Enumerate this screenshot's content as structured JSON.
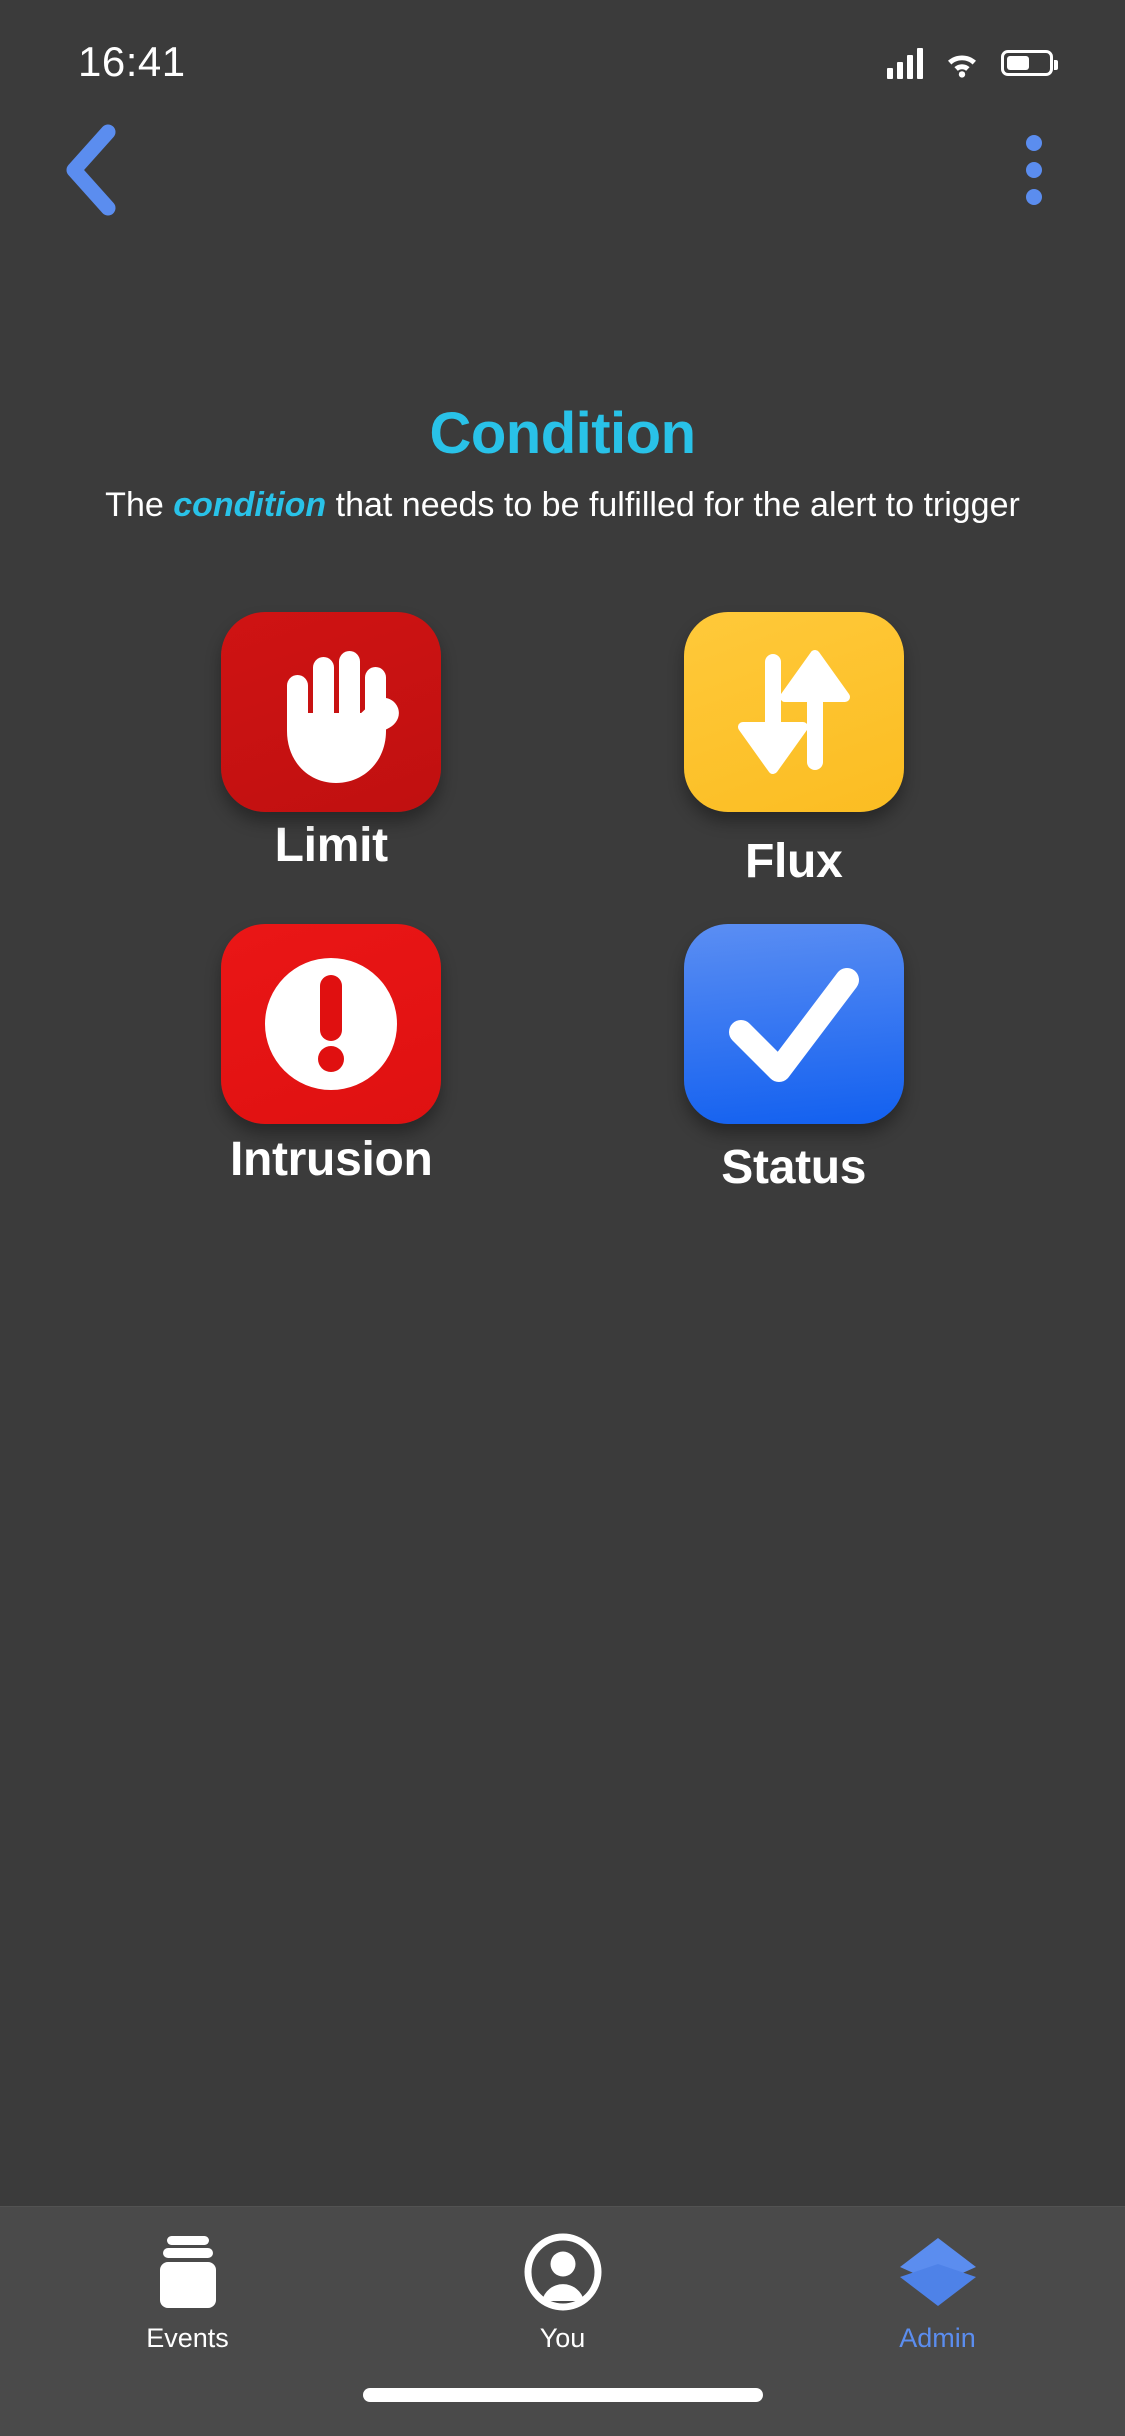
{
  "status_bar": {
    "time": "16:41",
    "signal_icon": "cellular-signal-icon",
    "wifi_icon": "wifi-icon",
    "battery_icon": "battery-icon"
  },
  "nav": {
    "back_icon": "chevron-left-icon",
    "menu_icon": "overflow-menu-icon"
  },
  "header": {
    "title": "Condition",
    "subtitle_prefix": "The ",
    "subtitle_highlight": "condition",
    "subtitle_suffix": " that needs to be fulfilled for the alert to trigger"
  },
  "colors": {
    "accent_cyan": "#29c2e8",
    "accent_blue": "#5b8def",
    "page_bg": "#3b3b3b",
    "tabbar_bg": "#4a4a4a",
    "limit_red": "#c81313",
    "flux_amber": "#fbbd22",
    "intrusion_red": "#e51616",
    "status_blue": "#1260f0"
  },
  "options": [
    {
      "id": "limit",
      "label": "Limit",
      "icon": "hand-stop-icon",
      "color": "#c81313"
    },
    {
      "id": "flux",
      "label": "Flux",
      "icon": "up-down-arrows-icon",
      "color": "#fbbd22"
    },
    {
      "id": "intrusion",
      "label": "Intrusion",
      "icon": "exclamation-circle-icon",
      "color": "#e51616"
    },
    {
      "id": "status",
      "label": "Status",
      "icon": "checkmark-icon",
      "color": "#1260f0"
    }
  ],
  "tabbar": {
    "items": [
      {
        "id": "events",
        "label": "Events",
        "icon": "database-jar-icon",
        "active": false
      },
      {
        "id": "you",
        "label": "You",
        "icon": "person-circle-icon",
        "active": false
      },
      {
        "id": "admin",
        "label": "Admin",
        "icon": "layers-icon",
        "active": true
      }
    ]
  }
}
